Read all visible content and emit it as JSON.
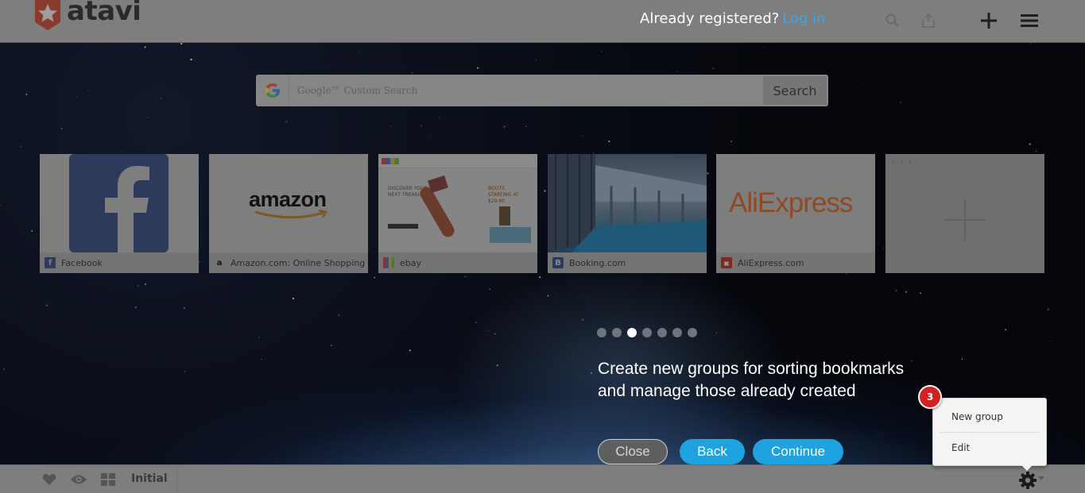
{
  "header": {
    "brand": "atavi",
    "registered_text": "Already registered?",
    "login_label": "Log in"
  },
  "search": {
    "placeholder_brand": "Google",
    "placeholder": "Google™ Custom Search",
    "button_label": "Search"
  },
  "tiles": [
    {
      "title": "Facebook"
    },
    {
      "title": "Amazon.com: Online Shopping"
    },
    {
      "title": "ebay"
    },
    {
      "title": "Booking.com"
    },
    {
      "title": "AliExpress.com"
    }
  ],
  "thumb_text": {
    "amazon_logo": "amazon",
    "aliexpress_logo": "AliExpress",
    "ebay_promo_line1": "DISCOVER YOUR",
    "ebay_promo_line2": "NEXT TREASURE",
    "ebay_promo_right": "BOOTS STARTING AT $29.90"
  },
  "tour": {
    "total_steps": 7,
    "current_step_index": 2,
    "text": "Create new groups for sorting bookmarks and manage those already created",
    "close_label": "Close",
    "back_label": "Back",
    "continue_label": "Continue",
    "step_badge": "3"
  },
  "popup_menu": {
    "items": [
      {
        "label": "New group"
      },
      {
        "label": "Edit"
      }
    ]
  },
  "footer": {
    "group_label": "Initial"
  },
  "colors": {
    "accent": "#1fa2e0",
    "login_link": "#3fa3e6",
    "badge": "#d6201f",
    "brand_red": "#d9452c"
  }
}
